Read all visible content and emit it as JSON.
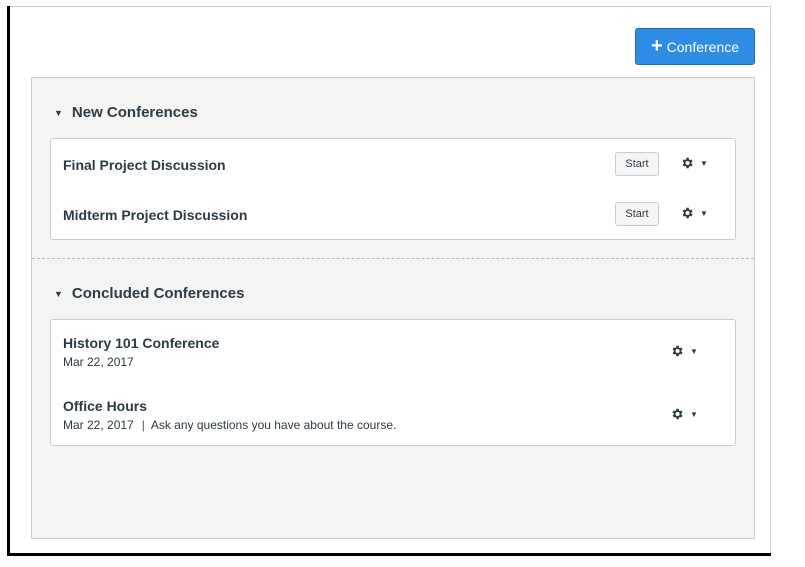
{
  "toolbar": {
    "add_label": "Conference",
    "add_icon": "plus-icon"
  },
  "new_section": {
    "title": "New Conferences",
    "items": [
      {
        "title": "Final Project Discussion",
        "start_label": "Start"
      },
      {
        "title": "Midterm Project Discussion",
        "start_label": "Start"
      }
    ]
  },
  "concluded_section": {
    "title": "Concluded Conferences",
    "items": [
      {
        "title": "History 101 Conference",
        "date": "Mar 22, 2017",
        "description": ""
      },
      {
        "title": "Office Hours",
        "date": "Mar 22, 2017",
        "separator": "|",
        "description": "Ask any questions you have about the course."
      }
    ]
  },
  "colors": {
    "primary_button": "#2d8de4",
    "panel_bg": "#f4f4f4",
    "text": "#2d3b45"
  }
}
